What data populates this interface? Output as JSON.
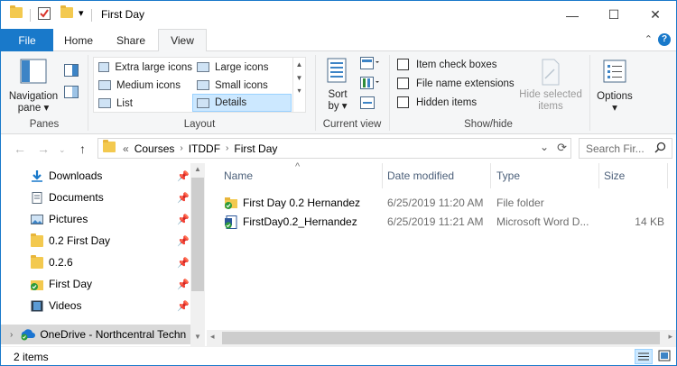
{
  "window": {
    "title": "First Day",
    "controls": {
      "minimize": "—",
      "maximize": "☐",
      "close": "✕"
    }
  },
  "quick_access_toolbar": {
    "customize_arrow": "▾"
  },
  "ribbon_tabs": {
    "file": "File",
    "home": "Home",
    "share": "Share",
    "view": "View",
    "collapse_arrow": "⌃",
    "help": "?"
  },
  "ribbon": {
    "panes": {
      "label": "Panes",
      "navigation_pane_line1": "Navigation",
      "navigation_pane_line2": "pane ▾"
    },
    "layout": {
      "label": "Layout",
      "items": [
        {
          "label": "Extra large icons"
        },
        {
          "label": "Large icons"
        },
        {
          "label": "Medium icons"
        },
        {
          "label": "Small icons"
        },
        {
          "label": "List"
        },
        {
          "label": "Details"
        }
      ],
      "selected": "Details"
    },
    "current_view": {
      "label": "Current view",
      "sort_by_line1": "Sort",
      "sort_by_line2": "by ▾"
    },
    "show_hide": {
      "label": "Show/hide",
      "item_check_boxes": "Item check boxes",
      "file_name_extensions": "File name extensions",
      "hidden_items": "Hidden items",
      "hide_selected_line1": "Hide selected",
      "hide_selected_line2": "items"
    },
    "options": {
      "label": "Options",
      "arrow": "▾"
    }
  },
  "address_bar": {
    "prefix": "«",
    "breadcrumbs": [
      "Courses",
      "ITDDF",
      "First Day"
    ],
    "dropdown": "⌄",
    "refresh": "⟳"
  },
  "search": {
    "placeholder": "Search Fir..."
  },
  "nav_pane": {
    "items": [
      {
        "label": "Downloads",
        "pinned": true
      },
      {
        "label": "Documents",
        "pinned": true
      },
      {
        "label": "Pictures",
        "pinned": true
      },
      {
        "label": "0.2 First Day",
        "pinned": true
      },
      {
        "label": "0.2.6",
        "pinned": true
      },
      {
        "label": "First Day",
        "pinned": true
      },
      {
        "label": "Videos",
        "pinned": true
      }
    ],
    "onedrive": "OneDrive - Northcentral Techn"
  },
  "content": {
    "columns": [
      "Name",
      "Date modified",
      "Type",
      "Size"
    ],
    "sort_indicator": "^",
    "rows": [
      {
        "name": "First Day 0.2 Hernandez",
        "date": "6/25/2019 11:20 AM",
        "type": "File folder",
        "size": ""
      },
      {
        "name": "FirstDay0.2_Hernandez",
        "date": "6/25/2019 11:21 AM",
        "type": "Microsoft Word D...",
        "size": "14 KB"
      }
    ]
  },
  "status_bar": {
    "item_count": "2 items"
  },
  "colors": {
    "accent": "#1979ca",
    "ribbon_bg": "#f5f6f7",
    "selected": "#cce8ff",
    "header_text": "#4c607a"
  }
}
